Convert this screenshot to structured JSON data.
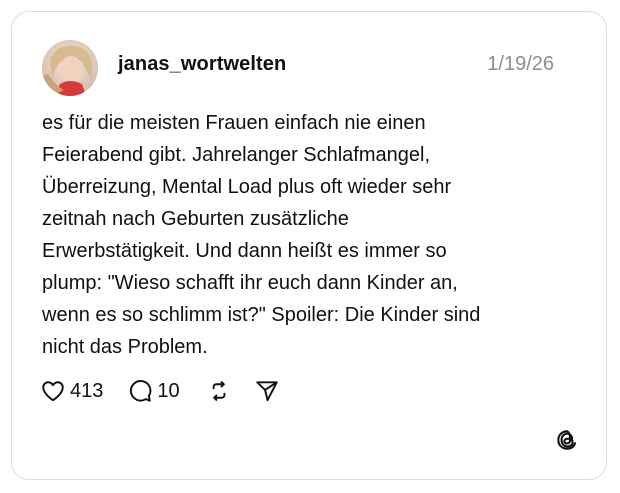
{
  "post": {
    "username": "janas_wortwelten",
    "timestamp": "1/19/26",
    "avatar_icon": "profile-photo",
    "text_lines": [
      "es für die meisten Frauen einfach nie einen",
      "Feierabend gibt. Jahrelanger Schlafmangel,",
      "Überreizung, Mental Load plus oft wieder sehr",
      "zeitnah nach Geburten zusätzliche",
      "Erwerbstätigkeit. Und dann heißt es immer so",
      "plump: \"Wieso schafft ihr euch dann Kinder an,",
      "wenn es so schlimm ist?\" Spoiler: Die Kinder sind",
      "nicht das Problem."
    ]
  },
  "actions": {
    "likes": "413",
    "replies": "10",
    "icons": [
      "heart-icon",
      "reply-bubble-icon",
      "repost-icon",
      "share-send-icon"
    ]
  },
  "branding": {
    "logo": "threads-logo-icon"
  },
  "colors": {
    "text": "#111111",
    "muted": "#8e8e8e",
    "border": "#dcdcdc"
  }
}
